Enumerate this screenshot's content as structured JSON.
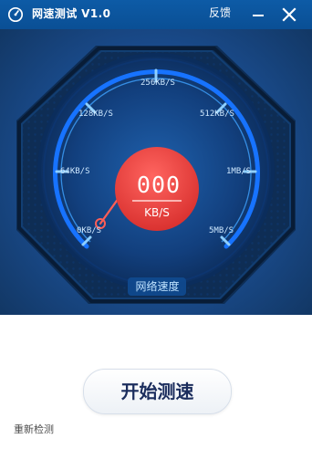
{
  "window": {
    "title": "网速测试 V1.0",
    "feedback_label": "反馈",
    "minimize_icon": "minimize-icon",
    "close_icon": "close-icon"
  },
  "meter": {
    "current_value": "000",
    "current_unit": "KB/S",
    "caption": "网络速度",
    "scale_labels": [
      "0KB/S",
      "64KB/S",
      "128KB/S",
      "256KB/S",
      "512KB/S",
      "1MB/S",
      "5MB/S"
    ]
  },
  "actions": {
    "start_label": "开始测速",
    "recheck_label": "重新检测"
  },
  "colors": {
    "title_bar": "#0d5ba6",
    "stage": "#1a4c8e",
    "accent": "#e63f3a",
    "blue_line": "#0a4a8b"
  }
}
